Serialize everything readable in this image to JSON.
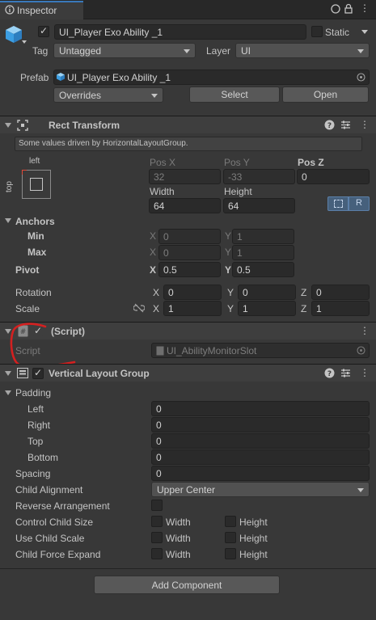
{
  "tab": {
    "title": "Inspector"
  },
  "object": {
    "active": true,
    "name": "UI_Player Exo Ability _1",
    "static_label": "Static",
    "tag_label": "Tag",
    "tag_value": "Untagged",
    "layer_label": "Layer",
    "layer_value": "UI",
    "prefab_label": "Prefab",
    "prefab_value": "UI_Player Exo Ability _1",
    "overrides": "Overrides",
    "select": "Select",
    "open": "Open"
  },
  "rect_transform": {
    "title": "Rect Transform",
    "notice": "Some values driven by HorizontalLayoutGroup.",
    "anchor_h": "left",
    "anchor_v": "top",
    "pos_x_label": "Pos X",
    "pos_x": "32",
    "pos_y_label": "Pos Y",
    "pos_y": "-33",
    "pos_z_label": "Pos Z",
    "pos_z": "0",
    "width_label": "Width",
    "width": "64",
    "height_label": "Height",
    "height": "64",
    "r_button": "R",
    "anchors_label": "Anchors",
    "min_label": "Min",
    "min_x_label": "X",
    "min_x": "0",
    "min_y_label": "Y",
    "min_y": "1",
    "max_label": "Max",
    "max_x_label": "X",
    "max_x": "0",
    "max_y_label": "Y",
    "max_y": "1",
    "pivot_label": "Pivot",
    "pivot_x_label": "X",
    "pivot_x": "0.5",
    "pivot_y_label": "Y",
    "pivot_y": "0.5",
    "rotation_label": "Rotation",
    "rot_x_label": "X",
    "rot_x": "0",
    "rot_y_label": "Y",
    "rot_y": "0",
    "rot_z_label": "Z",
    "rot_z": "0",
    "scale_label": "Scale",
    "scale_x_label": "X",
    "scale_x": "1",
    "scale_y_label": "Y",
    "scale_y": "1",
    "scale_z_label": "Z",
    "scale_z": "1"
  },
  "script_component": {
    "title": "(Script)",
    "script_label": "Script",
    "script_value": "UI_AbilityMonitorSlot"
  },
  "layout_group": {
    "title": "Vertical Layout Group",
    "padding_label": "Padding",
    "left_label": "Left",
    "left": "0",
    "right_label": "Right",
    "right": "0",
    "top_label": "Top",
    "top": "0",
    "bottom_label": "Bottom",
    "bottom": "0",
    "spacing_label": "Spacing",
    "spacing": "0",
    "alignment_label": "Child Alignment",
    "alignment": "Upper Center",
    "reverse_label": "Reverse Arrangement",
    "control_label": "Control Child Size",
    "use_scale_label": "Use Child Scale",
    "expand_label": "Child Force Expand",
    "width_label": "Width",
    "height_label": "Height"
  },
  "add_component": "Add Component",
  "colors": {
    "accent": "#3a79bb",
    "annotation": "#d42020",
    "background": "#383838"
  }
}
